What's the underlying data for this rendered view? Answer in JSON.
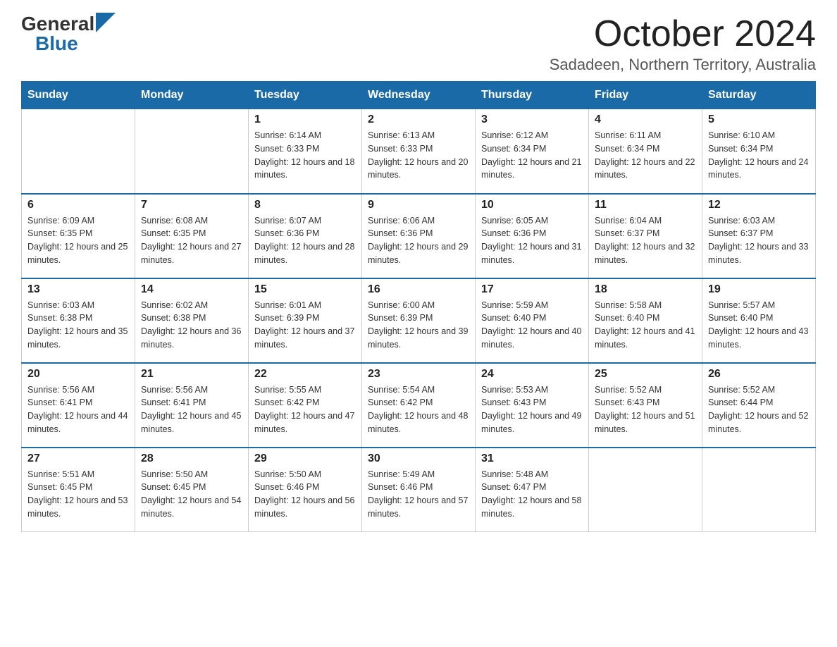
{
  "header": {
    "logo_general": "General",
    "logo_blue": "Blue",
    "month_title": "October 2024",
    "location": "Sadadeen, Northern Territory, Australia"
  },
  "days_of_week": [
    "Sunday",
    "Monday",
    "Tuesday",
    "Wednesday",
    "Thursday",
    "Friday",
    "Saturday"
  ],
  "weeks": [
    [
      {
        "day": "",
        "info": ""
      },
      {
        "day": "",
        "info": ""
      },
      {
        "day": "1",
        "info": "Sunrise: 6:14 AM\nSunset: 6:33 PM\nDaylight: 12 hours and 18 minutes."
      },
      {
        "day": "2",
        "info": "Sunrise: 6:13 AM\nSunset: 6:33 PM\nDaylight: 12 hours and 20 minutes."
      },
      {
        "day": "3",
        "info": "Sunrise: 6:12 AM\nSunset: 6:34 PM\nDaylight: 12 hours and 21 minutes."
      },
      {
        "day": "4",
        "info": "Sunrise: 6:11 AM\nSunset: 6:34 PM\nDaylight: 12 hours and 22 minutes."
      },
      {
        "day": "5",
        "info": "Sunrise: 6:10 AM\nSunset: 6:34 PM\nDaylight: 12 hours and 24 minutes."
      }
    ],
    [
      {
        "day": "6",
        "info": "Sunrise: 6:09 AM\nSunset: 6:35 PM\nDaylight: 12 hours and 25 minutes."
      },
      {
        "day": "7",
        "info": "Sunrise: 6:08 AM\nSunset: 6:35 PM\nDaylight: 12 hours and 27 minutes."
      },
      {
        "day": "8",
        "info": "Sunrise: 6:07 AM\nSunset: 6:36 PM\nDaylight: 12 hours and 28 minutes."
      },
      {
        "day": "9",
        "info": "Sunrise: 6:06 AM\nSunset: 6:36 PM\nDaylight: 12 hours and 29 minutes."
      },
      {
        "day": "10",
        "info": "Sunrise: 6:05 AM\nSunset: 6:36 PM\nDaylight: 12 hours and 31 minutes."
      },
      {
        "day": "11",
        "info": "Sunrise: 6:04 AM\nSunset: 6:37 PM\nDaylight: 12 hours and 32 minutes."
      },
      {
        "day": "12",
        "info": "Sunrise: 6:03 AM\nSunset: 6:37 PM\nDaylight: 12 hours and 33 minutes."
      }
    ],
    [
      {
        "day": "13",
        "info": "Sunrise: 6:03 AM\nSunset: 6:38 PM\nDaylight: 12 hours and 35 minutes."
      },
      {
        "day": "14",
        "info": "Sunrise: 6:02 AM\nSunset: 6:38 PM\nDaylight: 12 hours and 36 minutes."
      },
      {
        "day": "15",
        "info": "Sunrise: 6:01 AM\nSunset: 6:39 PM\nDaylight: 12 hours and 37 minutes."
      },
      {
        "day": "16",
        "info": "Sunrise: 6:00 AM\nSunset: 6:39 PM\nDaylight: 12 hours and 39 minutes."
      },
      {
        "day": "17",
        "info": "Sunrise: 5:59 AM\nSunset: 6:40 PM\nDaylight: 12 hours and 40 minutes."
      },
      {
        "day": "18",
        "info": "Sunrise: 5:58 AM\nSunset: 6:40 PM\nDaylight: 12 hours and 41 minutes."
      },
      {
        "day": "19",
        "info": "Sunrise: 5:57 AM\nSunset: 6:40 PM\nDaylight: 12 hours and 43 minutes."
      }
    ],
    [
      {
        "day": "20",
        "info": "Sunrise: 5:56 AM\nSunset: 6:41 PM\nDaylight: 12 hours and 44 minutes."
      },
      {
        "day": "21",
        "info": "Sunrise: 5:56 AM\nSunset: 6:41 PM\nDaylight: 12 hours and 45 minutes."
      },
      {
        "day": "22",
        "info": "Sunrise: 5:55 AM\nSunset: 6:42 PM\nDaylight: 12 hours and 47 minutes."
      },
      {
        "day": "23",
        "info": "Sunrise: 5:54 AM\nSunset: 6:42 PM\nDaylight: 12 hours and 48 minutes."
      },
      {
        "day": "24",
        "info": "Sunrise: 5:53 AM\nSunset: 6:43 PM\nDaylight: 12 hours and 49 minutes."
      },
      {
        "day": "25",
        "info": "Sunrise: 5:52 AM\nSunset: 6:43 PM\nDaylight: 12 hours and 51 minutes."
      },
      {
        "day": "26",
        "info": "Sunrise: 5:52 AM\nSunset: 6:44 PM\nDaylight: 12 hours and 52 minutes."
      }
    ],
    [
      {
        "day": "27",
        "info": "Sunrise: 5:51 AM\nSunset: 6:45 PM\nDaylight: 12 hours and 53 minutes."
      },
      {
        "day": "28",
        "info": "Sunrise: 5:50 AM\nSunset: 6:45 PM\nDaylight: 12 hours and 54 minutes."
      },
      {
        "day": "29",
        "info": "Sunrise: 5:50 AM\nSunset: 6:46 PM\nDaylight: 12 hours and 56 minutes."
      },
      {
        "day": "30",
        "info": "Sunrise: 5:49 AM\nSunset: 6:46 PM\nDaylight: 12 hours and 57 minutes."
      },
      {
        "day": "31",
        "info": "Sunrise: 5:48 AM\nSunset: 6:47 PM\nDaylight: 12 hours and 58 minutes."
      },
      {
        "day": "",
        "info": ""
      },
      {
        "day": "",
        "info": ""
      }
    ]
  ]
}
